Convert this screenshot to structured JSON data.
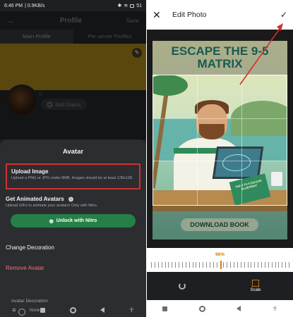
{
  "left": {
    "statusbar": {
      "time": "6:46 PM",
      "speed": "0.9KB/s",
      "battery": "51"
    },
    "profile": {
      "back_icon": "arrow-left-icon",
      "title": "Profile",
      "save": "Save",
      "tabs": [
        "Main Profile",
        "Per-server Profiles"
      ],
      "add_status": "Add Status"
    },
    "sheet": {
      "title": "Avatar",
      "upload_title": "Upload Image",
      "upload_sub": "Upload a PNG or JPG under 8MB. Images should be at least 128x128.",
      "animated_title": "Get Animated Avatars",
      "animated_sub": "Upload GIFs to animate your avatars! Only with Nitro.",
      "unlock_label": "Unlock with Nitro",
      "change_decoration": "Change Decoration",
      "remove_avatar": "Remove Avatar",
      "avatar_decoration_label": "Avatar Decoration",
      "none_label": "None"
    },
    "colors": {
      "highlight_border": "#d32f2f",
      "nitro_green": "#248046",
      "danger_red": "#f87171"
    }
  },
  "right": {
    "header": {
      "close_icon": "close-icon",
      "title": "Edit Photo",
      "confirm_icon": "checkmark-icon"
    },
    "poster": {
      "headline": "ESCAPE THE 9-5 MATRIX",
      "book_text": "THE 9 TO 5 ESCAPE BLUEPRINT",
      "cta": "DOWNLOAD BOOK"
    },
    "zoom": {
      "percent_label": "96%",
      "value": 96
    },
    "toolbar": {
      "rotate_icon": "rotate-icon",
      "scale_icon": "scale-icon",
      "scale_label": "Scale"
    },
    "colors": {
      "accent_orange": "#e07b00",
      "annotation_arrow": "#d32f2f"
    }
  }
}
